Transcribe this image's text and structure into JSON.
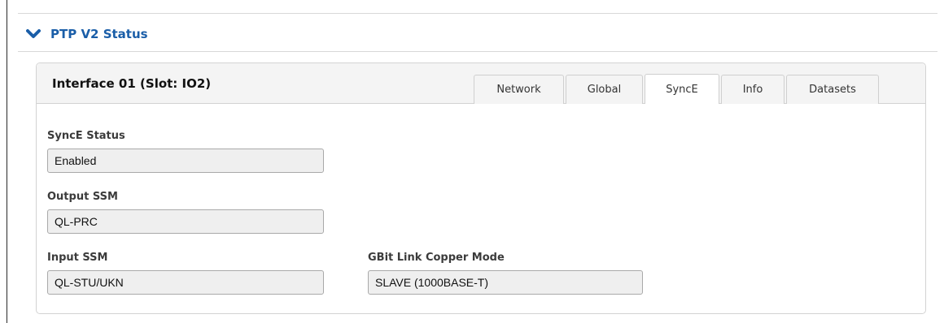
{
  "section": {
    "title": "PTP V2 Status",
    "icon": "chevron-down-icon",
    "accent_color": "#1a5ea8"
  },
  "panel": {
    "title": "Interface 01 (Slot: IO2)",
    "tabs": [
      {
        "label": "Network",
        "active": false
      },
      {
        "label": "Global",
        "active": false
      },
      {
        "label": "SyncE",
        "active": true
      },
      {
        "label": "Info",
        "active": false
      },
      {
        "label": "Datasets",
        "active": false
      }
    ]
  },
  "fields": {
    "synce_status": {
      "label": "SyncE Status",
      "value": "Enabled"
    },
    "output_ssm": {
      "label": "Output SSM",
      "value": "QL-PRC"
    },
    "input_ssm": {
      "label": "Input SSM",
      "value": "QL-STU/UKN"
    },
    "gbit_link_copper_mode": {
      "label": "GBit Link Copper Mode",
      "value": "SLAVE (1000BASE-T)"
    }
  }
}
